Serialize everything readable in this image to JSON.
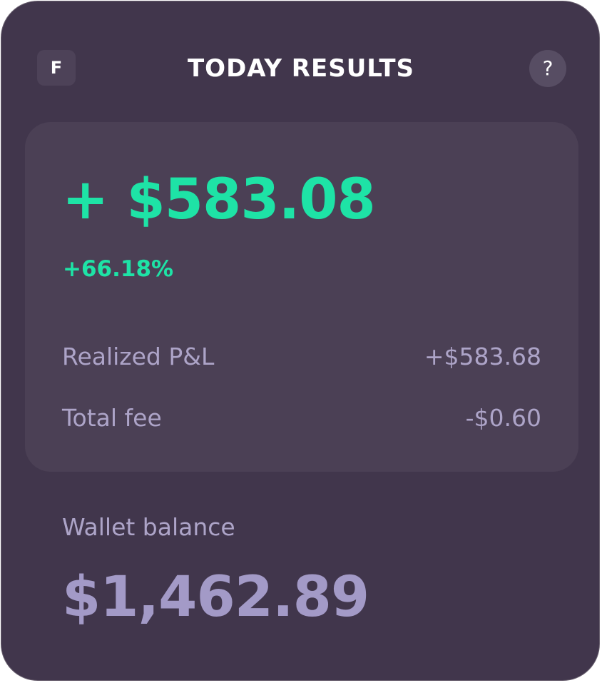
{
  "header": {
    "logo_letter": "F",
    "title": "TODAY RESULTS",
    "help_glyph": "?",
    "help_icon": "question-mark-icon"
  },
  "results": {
    "pnl_amount": "+ $583.08",
    "pnl_percent": "+66.18%",
    "rows": [
      {
        "label": "Realized P&L",
        "value": "+$583.68"
      },
      {
        "label": "Total fee",
        "value": "-$0.60"
      }
    ]
  },
  "wallet": {
    "label": "Wallet balance",
    "amount": "$1,462.89"
  },
  "colors": {
    "card_background": "#41364c",
    "panel_background": "#4b4055",
    "positive": "#1ee3a6",
    "muted_text": "#ada4c8",
    "title_text": "#ffffff"
  }
}
